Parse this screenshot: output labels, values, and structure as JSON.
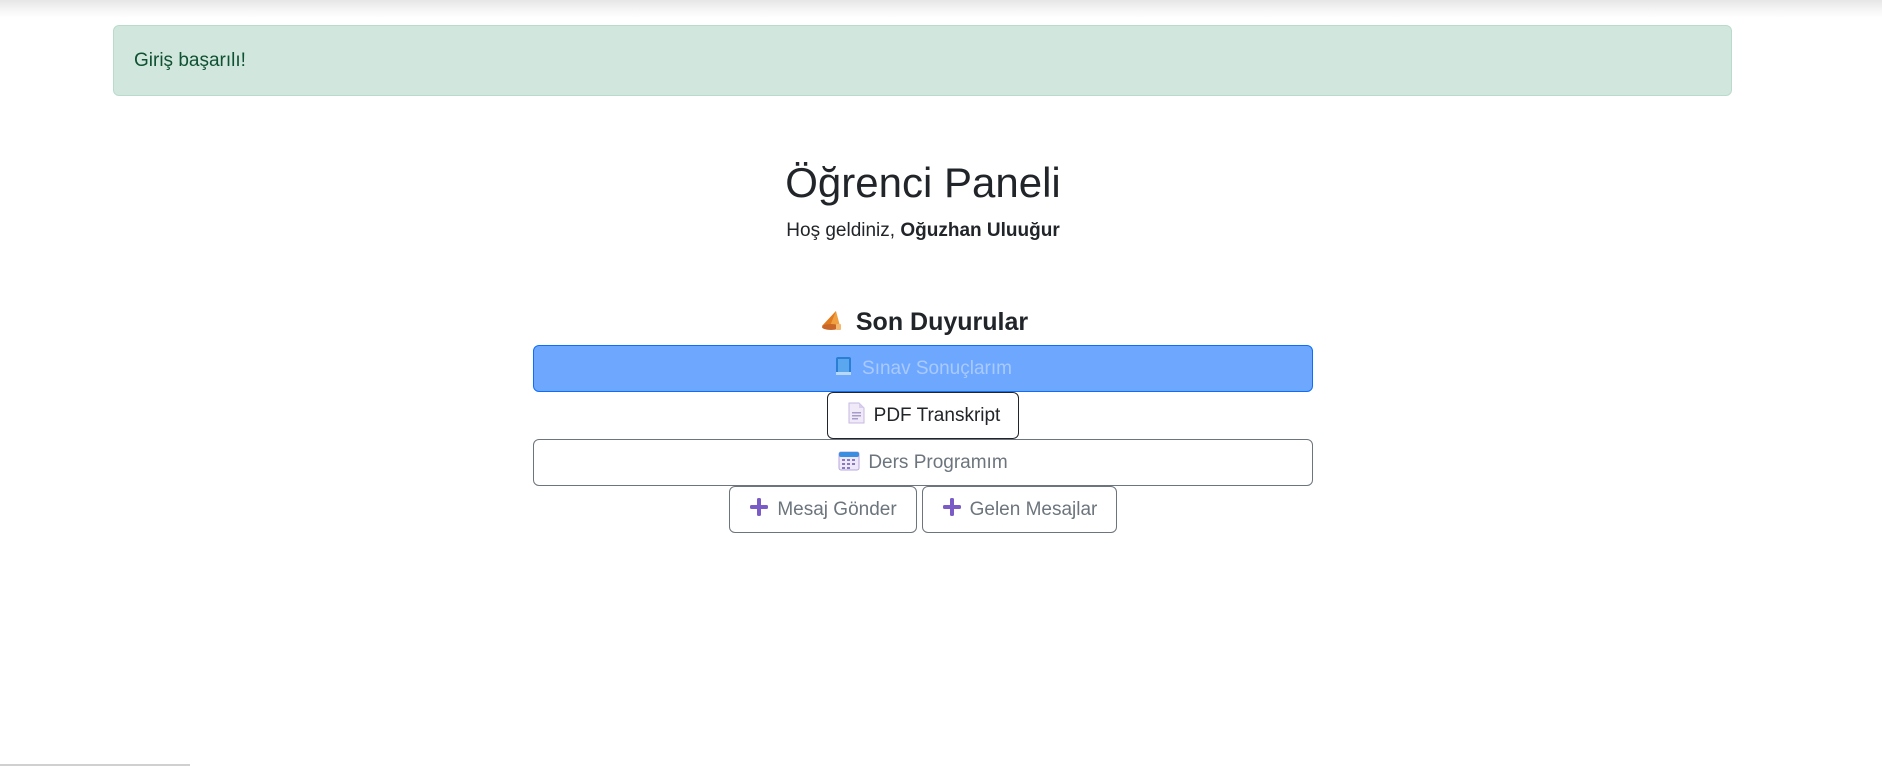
{
  "alert": {
    "message": "Giriş başarılı!"
  },
  "header": {
    "title": "Öğrenci Paneli",
    "welcome_prefix": "Hoş geldiniz, ",
    "user_name": "Oğuzhan Uluuğur"
  },
  "announcements": {
    "heading": "Son Duyurular",
    "icon": "megaphone-icon"
  },
  "actions": {
    "exam_results": {
      "label": "Sınav Sonuçlarım",
      "icon": "book-icon"
    },
    "pdf_transcript": {
      "label": "PDF Transkript",
      "icon": "document-icon"
    },
    "schedule": {
      "label": "Ders Programım",
      "icon": "calendar-icon"
    },
    "send_message": {
      "label": "Mesaj Gönder",
      "icon": "plus-icon"
    },
    "inbox": {
      "label": "Gelen Mesajlar",
      "icon": "plus-icon"
    }
  },
  "colors": {
    "alert_bg": "#d1e7dd",
    "alert_text": "#0f5132",
    "primary_btn_bg": "#6ea8fe",
    "plus_icon": "#7b5cc7"
  }
}
